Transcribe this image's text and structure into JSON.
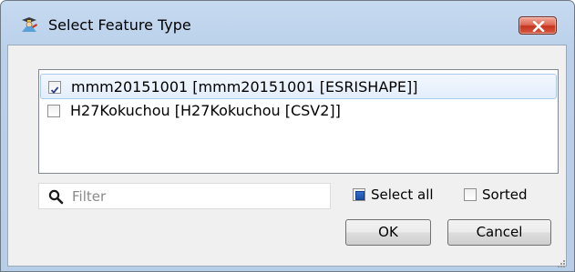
{
  "window": {
    "title": "Select Feature Type",
    "icon": "workbench-icon",
    "close_icon": "close-icon"
  },
  "feature_list": {
    "items": [
      {
        "label": "mmm20151001 [mmm20151001 [ESRISHAPE]]",
        "checked": true,
        "selected": true
      },
      {
        "label": "H27Kokuchou [H27Kokuchou [CSV2]]",
        "checked": false,
        "selected": false
      }
    ]
  },
  "filter": {
    "placeholder": "Filter",
    "value": "",
    "icon": "search-icon"
  },
  "options": {
    "select_all_label": "Select all",
    "select_all_state": "indeterminate",
    "sorted_label": "Sorted",
    "sorted_checked": false
  },
  "buttons": {
    "ok_label": "OK",
    "cancel_label": "Cancel"
  },
  "colors": {
    "title_bar": "#b9d0ea",
    "close_button": "#c5341f",
    "selection_border": "#a9c9ee",
    "select_all_fill": "#1c4fa8"
  }
}
